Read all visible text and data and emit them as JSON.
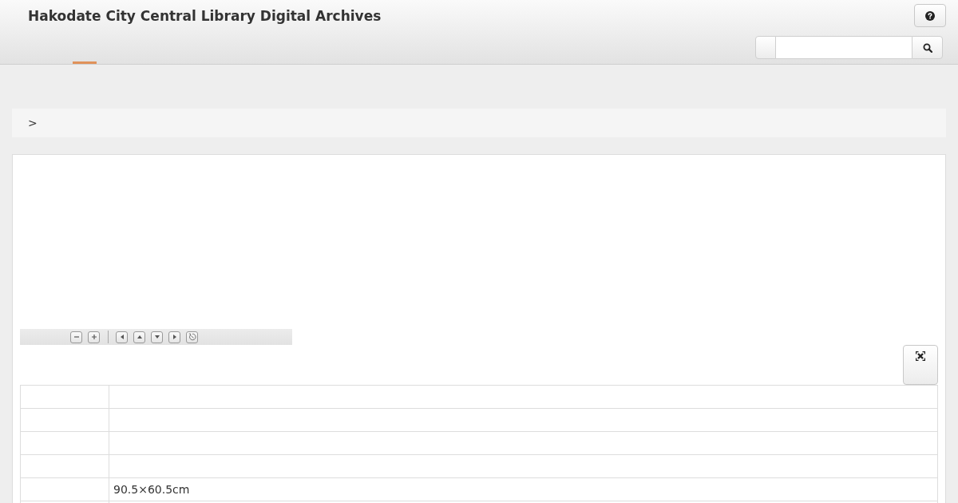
{
  "header": {
    "title": "Hakodate City Central Library Digital Archives"
  },
  "nav_tabs": [
    {
      "selected": true
    }
  ],
  "breadcrumb": {
    "separator": ">"
  },
  "table": {
    "rows": [
      {},
      {},
      {},
      {},
      {
        "value": "90.5×60.5cm"
      },
      {}
    ]
  }
}
